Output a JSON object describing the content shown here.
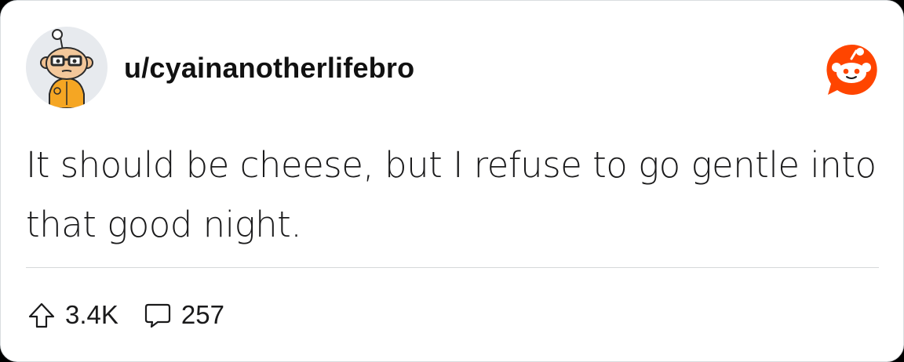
{
  "post": {
    "username": "u/cyainanotherlifebro",
    "body": "It should be cheese, but I refuse to go gentle into that good night.",
    "upvotes": "3.4K",
    "comments": "257"
  },
  "colors": {
    "accent": "#ff4500",
    "avatar_shirt": "#f5a623",
    "card_background": "#ffffff"
  },
  "icons": {
    "brand": "reddit-logo-icon",
    "upvote": "upvote-arrow-icon",
    "comment": "comment-bubble-icon"
  }
}
